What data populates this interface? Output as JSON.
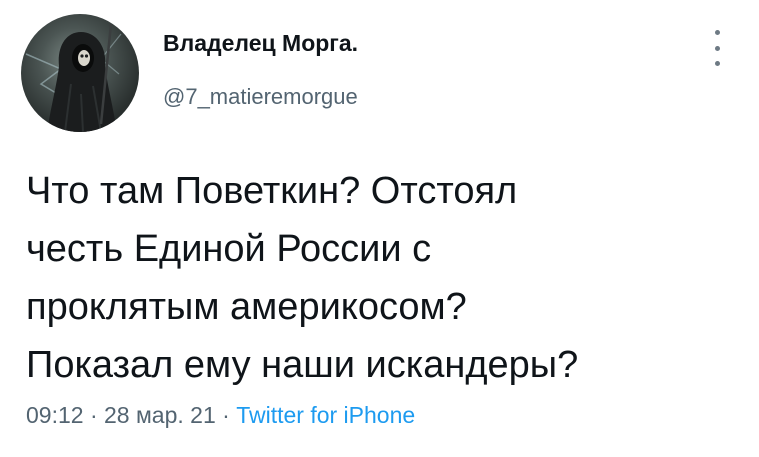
{
  "tweet": {
    "author": {
      "display_name": "Владелец Морга.",
      "handle": "@7_matieremorgue"
    },
    "text_lines": [
      "Что там Поветкин? Отстоял",
      "честь Единой России с",
      "проклятым америкосом?",
      "Показал ему наши искандеры?"
    ],
    "time": "09:12",
    "separator": "·",
    "date": "28 мар. 21",
    "source": "Twitter for iPhone"
  },
  "icons": {
    "more": "more-vertical-icon",
    "avatar": "grim-reaper-avatar"
  },
  "colors": {
    "text": "#0f1419",
    "secondary": "#536471",
    "link": "#1d9bf0",
    "background": "#ffffff"
  }
}
